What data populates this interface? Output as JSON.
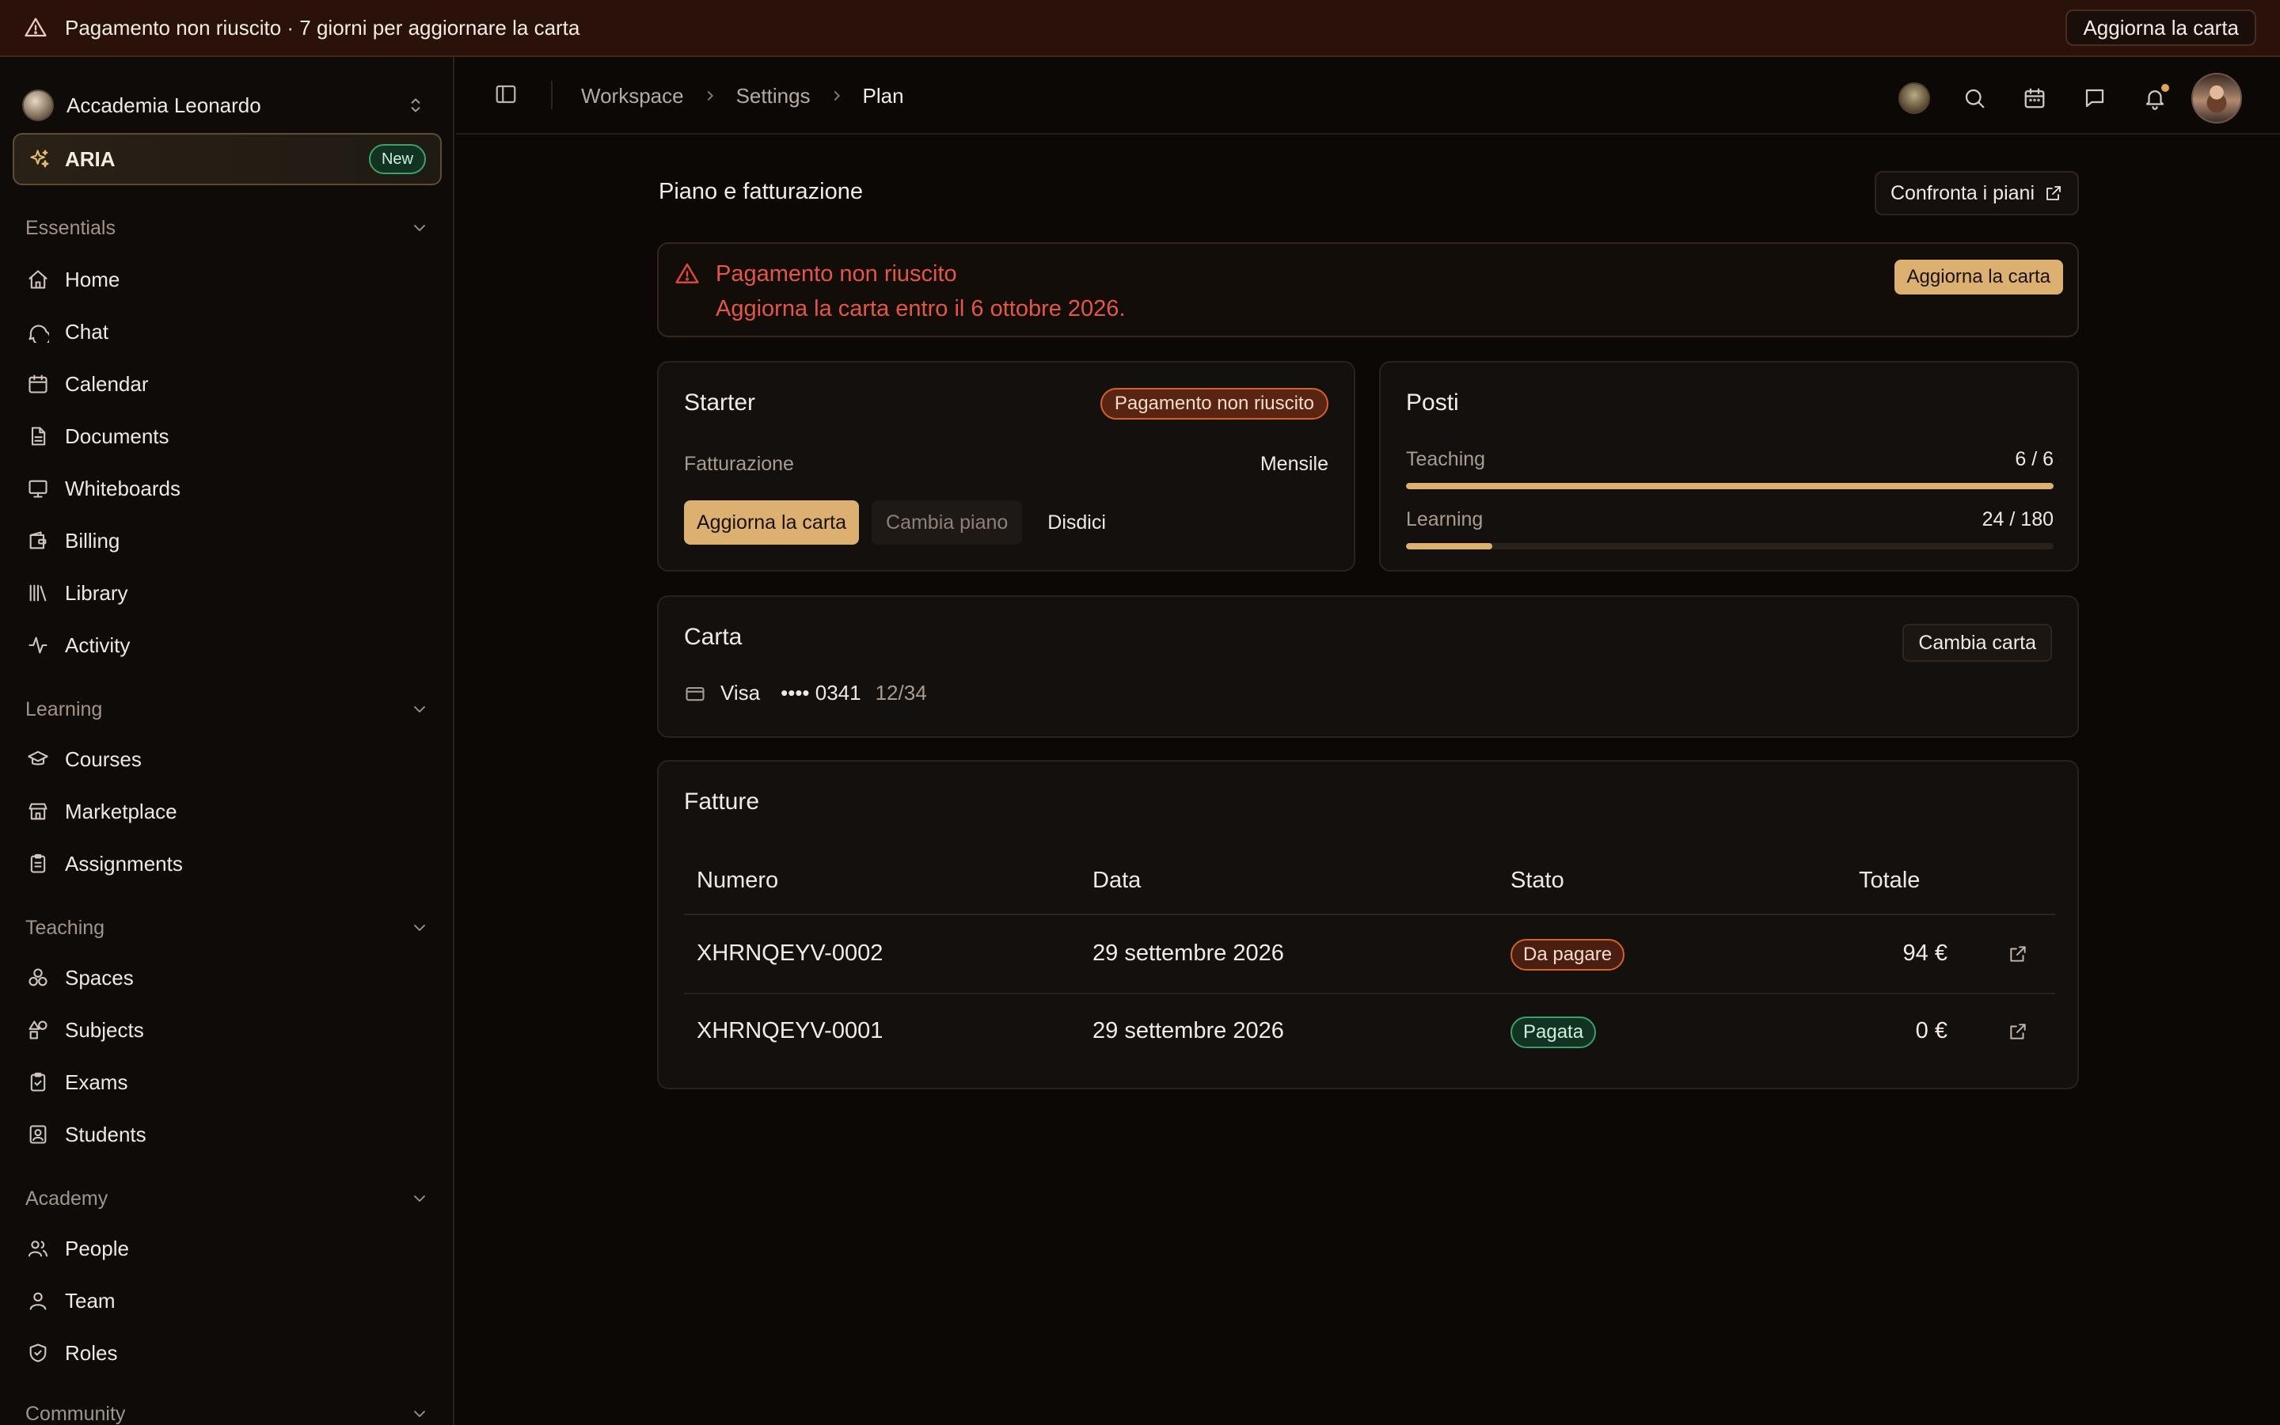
{
  "banner": {
    "text": "Pagamento non riuscito · 7 giorni per aggiornare la carta",
    "button": "Aggiorna la carta"
  },
  "sidebar": {
    "org_name": "Accademia Leonardo",
    "aria": {
      "label": "ARIA",
      "badge": "New"
    },
    "sections": [
      {
        "title": "Essentials",
        "items": [
          "Home",
          "Chat",
          "Calendar",
          "Documents",
          "Whiteboards",
          "Billing",
          "Library",
          "Activity"
        ]
      },
      {
        "title": "Learning",
        "items": [
          "Courses",
          "Marketplace",
          "Assignments"
        ]
      },
      {
        "title": "Teaching",
        "items": [
          "Spaces",
          "Subjects",
          "Exams",
          "Students"
        ]
      },
      {
        "title": "Academy",
        "items": [
          "People",
          "Team",
          "Roles"
        ]
      },
      {
        "title": "Community",
        "items": []
      }
    ]
  },
  "header": {
    "breadcrumb": [
      "Workspace",
      "Settings",
      "Plan"
    ]
  },
  "page": {
    "title": "Piano e fatturazione",
    "compare_button": "Confronta i piani"
  },
  "alert": {
    "title": "Pagamento non riuscito",
    "description": "Aggiorna la carta entro il 6 ottobre 2026.",
    "button": "Aggiorna la carta"
  },
  "plan": {
    "name": "Starter",
    "status": "Pagamento non riuscito",
    "billing_label": "Fatturazione",
    "billing_value": "Mensile",
    "primary_button": "Aggiorna la carta",
    "change_button": "Cambia piano",
    "cancel_button": "Disdici"
  },
  "seats": {
    "title": "Posti",
    "rows": [
      {
        "label": "Teaching",
        "value": "6 / 6",
        "fraction": 1.0
      },
      {
        "label": "Learning",
        "value": "24 / 180",
        "fraction": 0.1333
      }
    ]
  },
  "payment_card": {
    "title": "Carta",
    "change_button": "Cambia carta",
    "brand": "Visa",
    "number": "•••• 0341",
    "expiry": "12/34"
  },
  "invoices": {
    "title": "Fatture",
    "columns": [
      "Numero",
      "Data",
      "Stato",
      "Totale"
    ],
    "rows": [
      {
        "number": "XHRNQEYV-0002",
        "date": "29 settembre 2026",
        "status": "Da pagare",
        "total": "94 €"
      },
      {
        "number": "XHRNQEYV-0001",
        "date": "29 settembre 2026",
        "status": "Pagata",
        "total": "0 €"
      }
    ]
  },
  "colors": {
    "accent": "#dbb071",
    "danger": "#e45646",
    "success": "#3ba168",
    "warning": "#d4602c"
  }
}
